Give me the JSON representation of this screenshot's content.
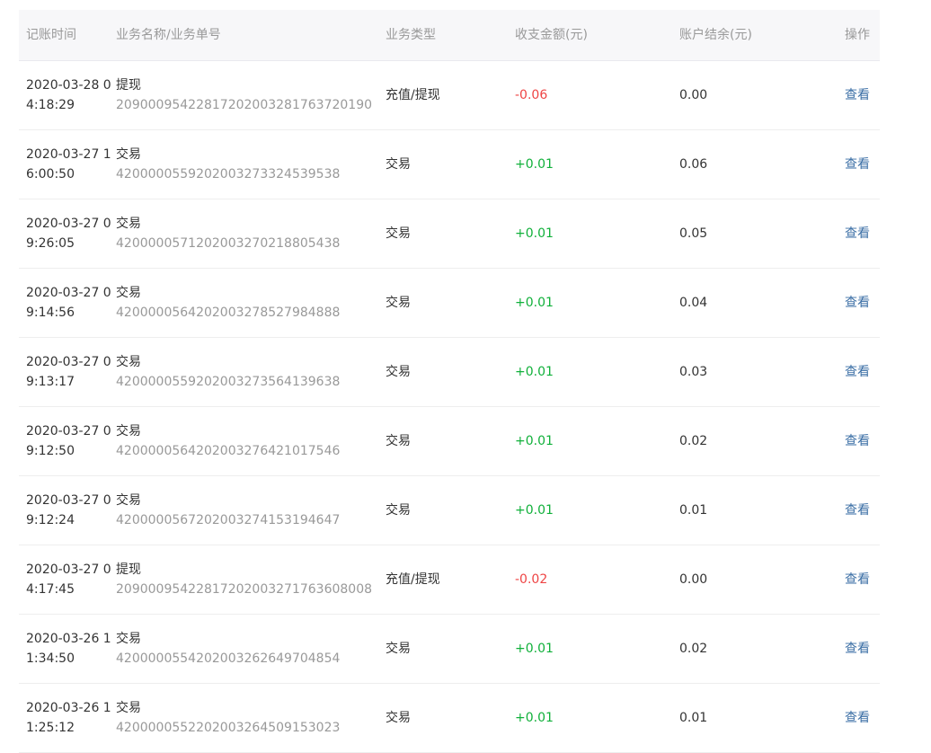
{
  "table": {
    "headers": {
      "time": "记账时间",
      "name": "业务名称/业务单号",
      "type": "业务类型",
      "amount": "收支金额(元)",
      "balance": "账户结余(元)",
      "action": "操作"
    },
    "rows": [
      {
        "time": "2020-03-28 04:18:29",
        "title": "提现",
        "number": "20900095422817202003281763720190",
        "type": "充值/提现",
        "amount": "-0.06",
        "balance": "0.00",
        "action": "查看"
      },
      {
        "time": "2020-03-27 16:00:50",
        "title": "交易",
        "number": "4200000559202003273324539538",
        "type": "交易",
        "amount": "+0.01",
        "balance": "0.06",
        "action": "查看"
      },
      {
        "time": "2020-03-27 09:26:05",
        "title": "交易",
        "number": "4200000571202003270218805438",
        "type": "交易",
        "amount": "+0.01",
        "balance": "0.05",
        "action": "查看"
      },
      {
        "time": "2020-03-27 09:14:56",
        "title": "交易",
        "number": "4200000564202003278527984888",
        "type": "交易",
        "amount": "+0.01",
        "balance": "0.04",
        "action": "查看"
      },
      {
        "time": "2020-03-27 09:13:17",
        "title": "交易",
        "number": "4200000559202003273564139638",
        "type": "交易",
        "amount": "+0.01",
        "balance": "0.03",
        "action": "查看"
      },
      {
        "time": "2020-03-27 09:12:50",
        "title": "交易",
        "number": "4200000564202003276421017546",
        "type": "交易",
        "amount": "+0.01",
        "balance": "0.02",
        "action": "查看"
      },
      {
        "time": "2020-03-27 09:12:24",
        "title": "交易",
        "number": "4200000567202003274153194647",
        "type": "交易",
        "amount": "+0.01",
        "balance": "0.01",
        "action": "查看"
      },
      {
        "time": "2020-03-27 04:17:45",
        "title": "提现",
        "number": "20900095422817202003271763608008",
        "type": "充值/提现",
        "amount": "-0.02",
        "balance": "0.00",
        "action": "查看"
      },
      {
        "time": "2020-03-26 11:34:50",
        "title": "交易",
        "number": "4200000554202003262649704854",
        "type": "交易",
        "amount": "+0.01",
        "balance": "0.02",
        "action": "查看"
      },
      {
        "time": "2020-03-26 11:25:12",
        "title": "交易",
        "number": "4200000552202003264509153023",
        "type": "交易",
        "amount": "+0.01",
        "balance": "0.01",
        "action": "查看"
      }
    ]
  },
  "colors": {
    "negative": "#ee4444",
    "positive": "#10b03a",
    "link": "#3a6ea5"
  }
}
